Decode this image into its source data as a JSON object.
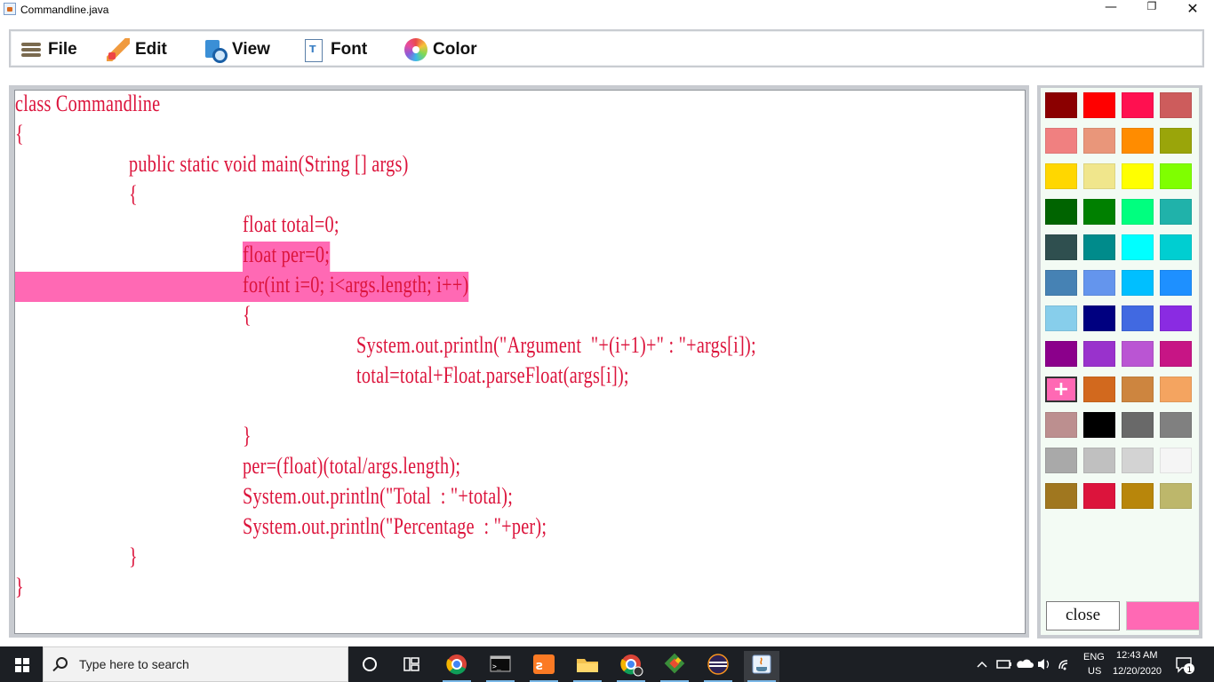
{
  "window": {
    "title": "Commandline.java",
    "minimize_glyph": "—",
    "maximize_glyph": "❐",
    "close_glyph": "✕"
  },
  "menu": [
    {
      "label": "File",
      "icon": "hamburger-icon"
    },
    {
      "label": "Edit",
      "icon": "pencil-icon"
    },
    {
      "label": "View",
      "icon": "document-search-icon"
    },
    {
      "label": "Font",
      "icon": "font-document-icon"
    },
    {
      "label": "Color",
      "icon": "color-wheel-icon"
    }
  ],
  "code": {
    "text_color": "#dc143c",
    "selection_color": "#ff69b4",
    "lines": [
      "class Commandline",
      "{",
      "public static void main(String [] args)",
      "{",
      "float total=0;",
      "float per=0;",
      "for(int i=0; i<args.length; i++)",
      "{",
      "System.out.println(\"Argument  \"+(i+1)+\" : \"+args[i]);",
      "total=total+Float.parseFloat(args[i]);",
      "",
      "}",
      "per=(float)(total/args.length);",
      "System.out.println(\"Total  : \"+total);",
      "System.out.println(\"Percentage  : \"+per);",
      "}",
      "}"
    ]
  },
  "palette": {
    "colors": [
      "#8b0000",
      "#ff0000",
      "#ff1050",
      "#cd5c5c",
      "#f08080",
      "#e9967a",
      "#ff8c00",
      "#9aa50a",
      "#ffd700",
      "#f0e68c",
      "#ffff00",
      "#7fff00",
      "#006400",
      "#008000",
      "#00ff7f",
      "#20b2aa",
      "#2f4f4f",
      "#008b8b",
      "#00ffff",
      "#00ced1",
      "#4682b4",
      "#6495ed",
      "#00bfff",
      "#1e90ff",
      "#87ceeb",
      "#000080",
      "#4169e1",
      "#8a2be2",
      "#8b008b",
      "#9932cc",
      "#ba55d3",
      "#c71585",
      "#ff69b4",
      "#d2691e",
      "#cd853f",
      "#f4a460",
      "#bc8f8f",
      "#000000",
      "#696969",
      "#808080",
      "#a9a9a9",
      "#c0c0c0",
      "#d3d3d3",
      "#f5f5f5",
      "#a0771f",
      "#dc143c",
      "#b8860b",
      "#bdb76b"
    ],
    "selected_index": 32,
    "close_label": "close",
    "preview_color": "#ff69b4"
  },
  "taskbar": {
    "search_placeholder": "Type here to search",
    "apps": [
      "task-view-icon",
      "chrome-icon",
      "terminal-icon",
      "xampp-icon",
      "file-explorer-icon",
      "chrome-profile-icon",
      "git-icon",
      "eclipse-icon",
      "java-icon"
    ],
    "tray": {
      "lang": "ENG",
      "region": "US",
      "time": "12:43 AM",
      "date": "12/20/2020",
      "notification_count": "1"
    }
  }
}
